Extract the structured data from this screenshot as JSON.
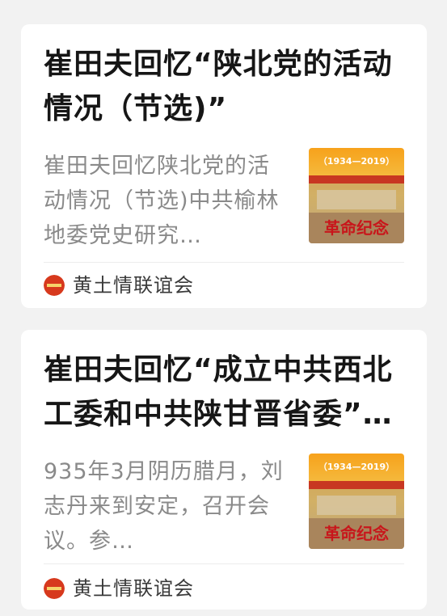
{
  "feed": {
    "articles": [
      {
        "title": "崔田夫回忆“陕北党的活动情况（节选)”",
        "summary": "崔田夫回忆陕北党的活动情况（节选)中共榆林地委党史研究…",
        "source": "黄土情联谊会",
        "thumbnail_text": "（1934—2019）",
        "thumbnail_banner": "革命纪念"
      },
      {
        "title": "崔田夫回忆“成立中共西北工委和中共陕甘晋省委”…",
        "summary": "935年3月阴历腊月，刘志丹来到安定，召开会议。参…",
        "source": "黄土情联谊会",
        "thumbnail_text": "（1934—2019）",
        "thumbnail_banner": "革命纪念"
      }
    ]
  }
}
